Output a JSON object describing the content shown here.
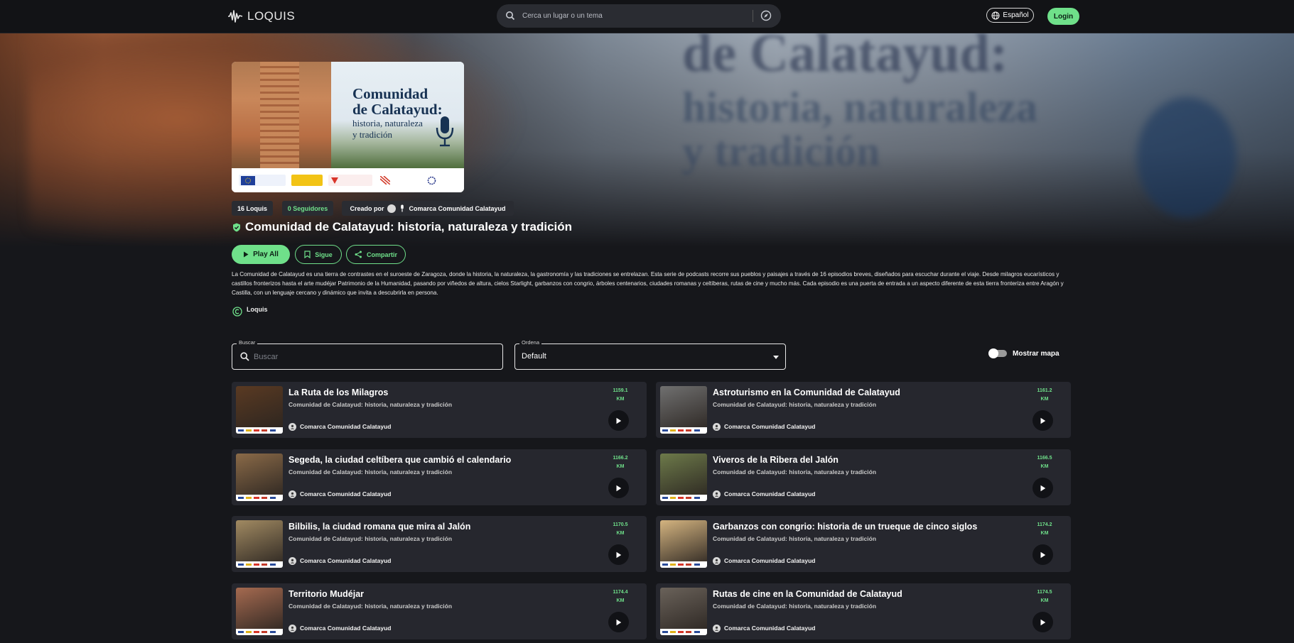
{
  "header": {
    "logo_text": "LOQUIS",
    "search_placeholder": "Cerca un lugar o un tema",
    "language_label": "Español",
    "login_label": "Login"
  },
  "cover": {
    "title_line1": "Comunidad",
    "title_line2": "de Calatayud:",
    "subtitle_line1": "historia, naturaleza",
    "subtitle_line2": "y tradición"
  },
  "stats": {
    "loquis_count": "16 Loquis",
    "followers": "0 Seguidores",
    "created_by_label": "Creado por",
    "creator_name": "Comarca Comunidad Calatayud"
  },
  "collection": {
    "title": "Comunidad de Calatayud: historia, naturaleza y tradición",
    "play_all_label": "Play All",
    "follow_label": "Sigue",
    "share_label": "Compartir",
    "description_line1": "La Comunidad de Calatayud es una tierra de contrastes en el suroeste de Zaragoza, donde la historia, la naturaleza, la gastronomía y las tradiciones se entrelazan. Esta serie de podcasts recorre sus pueblos y paisajes a través de 16 episodios breves, diseñados para escuchar durante el viaje.",
    "description_line2": "Desde milagros eucarísticos y castillos fronterizos hasta el arte mudéjar Patrimonio de la Humanidad, pasando por viñedos de altura, cielos Starlight, garbanzos con congrio, árboles centenarios, ciudades romanas y celtíberas, rutas de cine y mucho más. Cada episodio es una puerta de entrada a un aspecto diferente de esta tierra fronteriza entre Aragón y Castilla, con un lenguaje cercano y dinámico que invita a descubrirla en persona.",
    "license_author": "Loquis"
  },
  "filters": {
    "search_label": "Buscar",
    "search_placeholder": "Buscar",
    "order_label": "Ordena",
    "order_value": "Default",
    "map_toggle_label": "Mostrar mapa"
  },
  "episodes": [
    {
      "title": "La Ruta de los Milagros",
      "subtitle": "Comunidad de Calatayud: historia, naturaleza y tradición",
      "author": "Comarca Comunidad Calatayud",
      "distance": "1159.1",
      "unit": "KM",
      "thumb_color": "#5a3a22"
    },
    {
      "title": "Astroturismo en la Comunidad de Calatayud",
      "subtitle": "Comunidad de Calatayud: historia, naturaleza y tradición",
      "author": "Comarca Comunidad Calatayud",
      "distance": "1161.2",
      "unit": "KM",
      "thumb_color": "#707070"
    },
    {
      "title": "Segeda, la ciudad celtíbera que cambió el calendario",
      "subtitle": "Comunidad de Calatayud: historia, naturaleza y tradición",
      "author": "Comarca Comunidad Calatayud",
      "distance": "1166.2",
      "unit": "KM",
      "thumb_color": "#8a6a48"
    },
    {
      "title": "Viveros de la Ribera del Jalón",
      "subtitle": "Comunidad de Calatayud: historia, naturaleza y tradición",
      "author": "Comarca Comunidad Calatayud",
      "distance": "1166.5",
      "unit": "KM",
      "thumb_color": "#6d7a4a"
    },
    {
      "title": "Bilbilis, la ciudad romana que mira al Jalón",
      "subtitle": "Comunidad de Calatayud: historia, naturaleza y tradición",
      "author": "Comarca Comunidad Calatayud",
      "distance": "1170.5",
      "unit": "KM",
      "thumb_color": "#a18a62"
    },
    {
      "title": "Garbanzos con congrio: historia de un trueque de cinco siglos",
      "subtitle": "Comunidad de Calatayud: historia, naturaleza y tradición",
      "author": "Comarca Comunidad Calatayud",
      "distance": "1174.2",
      "unit": "KM",
      "thumb_color": "#d4b480"
    },
    {
      "title": "Territorio Mudéjar",
      "subtitle": "Comunidad de Calatayud: historia, naturaleza y tradición",
      "author": "Comarca Comunidad Calatayud",
      "distance": "1174.4",
      "unit": "KM",
      "thumb_color": "#a56a50"
    },
    {
      "title": "Rutas de cine en la Comunidad de Calatayud",
      "subtitle": "Comunidad de Calatayud: historia, naturaleza y tradición",
      "author": "Comarca Comunidad Calatayud",
      "distance": "1174.5",
      "unit": "KM",
      "thumb_color": "#6a625a"
    }
  ],
  "colors": {
    "accent": "#6fe08a",
    "background": "#16171b",
    "card": "#26272e"
  }
}
